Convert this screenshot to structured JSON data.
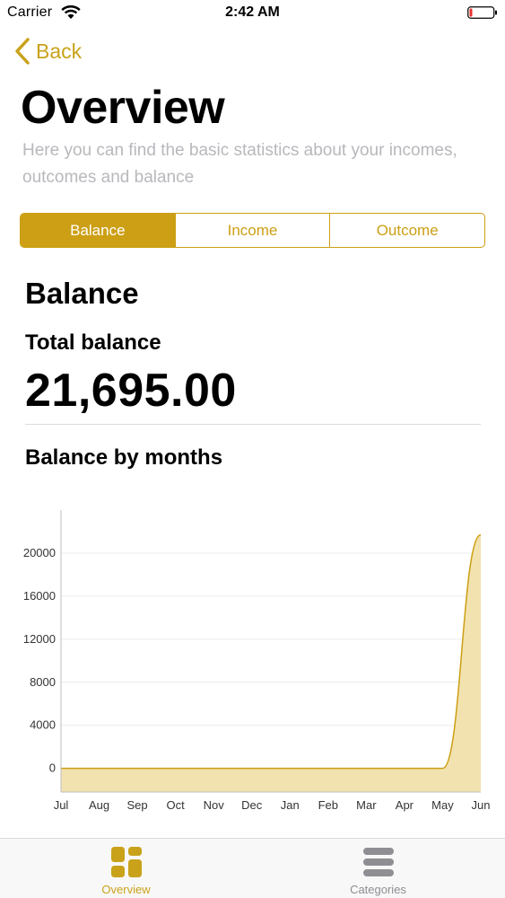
{
  "status_bar": {
    "carrier": "Carrier",
    "time": "2:42 AM"
  },
  "nav": {
    "back_label": "Back"
  },
  "header": {
    "title": "Overview",
    "subtitle": "Here you can find the basic statistics about your incomes, outcomes and balance"
  },
  "segments": [
    {
      "label": "Balance",
      "selected": true
    },
    {
      "label": "Income",
      "selected": false
    },
    {
      "label": "Outcome",
      "selected": false
    }
  ],
  "balance": {
    "section_title": "Balance",
    "total_label": "Total balance",
    "total_value": "21,695.00",
    "chart_title": "Balance by months"
  },
  "tabs": [
    {
      "label": "Overview",
      "icon": "grid-icon",
      "active": true
    },
    {
      "label": "Categories",
      "icon": "list-icon",
      "active": false
    }
  ],
  "colors": {
    "accent": "#cc9f14",
    "chart_fill": "#f2e2b0",
    "chart_line": "#cc9f14",
    "inactive": "#8e8e93"
  },
  "chart_data": {
    "type": "area",
    "categories": [
      "Jul",
      "Aug",
      "Sep",
      "Oct",
      "Nov",
      "Dec",
      "Jan",
      "Feb",
      "Mar",
      "Apr",
      "May",
      "Jun"
    ],
    "values": [
      0,
      0,
      0,
      0,
      0,
      0,
      0,
      0,
      0,
      0,
      0,
      21695
    ],
    "yticks": [
      0,
      4000,
      8000,
      12000,
      16000,
      20000
    ],
    "ylim": [
      -2200,
      24000
    ],
    "grid": true
  }
}
